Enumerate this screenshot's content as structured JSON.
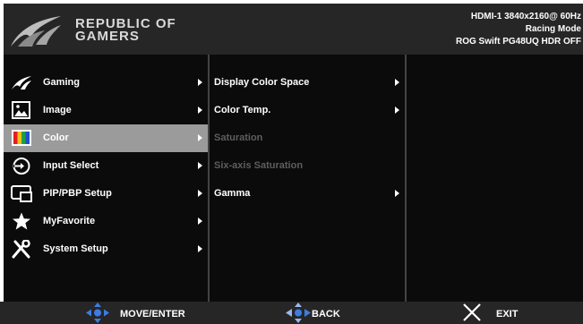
{
  "brand": {
    "line1": "REPUBLIC OF",
    "line2": "GAMERS",
    "logo_icon": "rog-eye-logo-icon"
  },
  "status": {
    "line1": "HDMI-1  3840x2160@  60Hz",
    "line2": "Racing Mode",
    "line3": "ROG Swift  PG48UQ  HDR OFF"
  },
  "main_menu": [
    {
      "label": "Gaming",
      "icon": "rog-logo-icon",
      "selected": false
    },
    {
      "label": "Image",
      "icon": "image-icon",
      "selected": false
    },
    {
      "label": "Color",
      "icon": "color-bars-icon",
      "selected": true
    },
    {
      "label": "Input Select",
      "icon": "input-select-icon",
      "selected": false
    },
    {
      "label": "PIP/PBP Setup",
      "icon": "pip-icon",
      "selected": false
    },
    {
      "label": "MyFavorite",
      "icon": "star-icon",
      "selected": false
    },
    {
      "label": "System Setup",
      "icon": "wrench-screwdriver-icon",
      "selected": false
    }
  ],
  "sub_menu": [
    {
      "label": "Display Color Space",
      "enabled": true,
      "has_arrow": true
    },
    {
      "label": "Color Temp.",
      "enabled": true,
      "has_arrow": true
    },
    {
      "label": "Saturation",
      "enabled": false,
      "has_arrow": false
    },
    {
      "label": "Six-axis Saturation",
      "enabled": false,
      "has_arrow": false
    },
    {
      "label": "Gamma",
      "enabled": true,
      "has_arrow": true
    }
  ],
  "footer": {
    "move_enter": "MOVE/ENTER",
    "back": "BACK",
    "exit": "EXIT"
  },
  "colors": {
    "selected_bg": "#9b9b9b",
    "disabled_text": "#5e5e5e",
    "joystick": "#3d7de0"
  }
}
